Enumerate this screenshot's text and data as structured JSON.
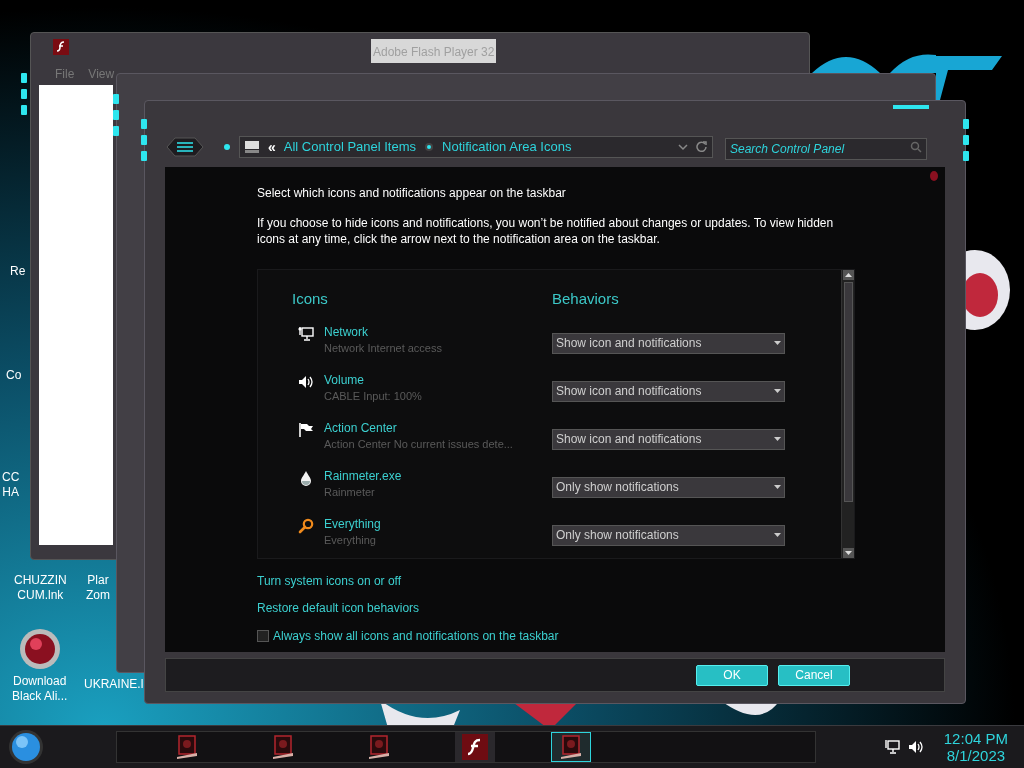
{
  "desktop_icons": [
    {
      "lines": [
        "Re"
      ],
      "kind": "partial"
    },
    {
      "lines": [
        "Co"
      ],
      "kind": "partial"
    },
    {
      "lines": [
        "CC",
        "HA"
      ],
      "kind": "partial"
    },
    {
      "lines": [
        "CHUZZIN",
        "CUM.lnk"
      ],
      "kind": "partial"
    },
    {
      "lines": [
        "Plar",
        "Zom"
      ],
      "kind": "partial"
    },
    {
      "lines": [
        "Download",
        "Black Ali..."
      ],
      "kind": "orb"
    },
    {
      "lines": [
        "UKRAINE.l"
      ],
      "kind": "partial"
    }
  ],
  "background_window": {
    "title": "Adobe Flash Player 32",
    "menu": [
      "File",
      "View"
    ]
  },
  "window": {
    "back_chevron": "«",
    "breadcrumb": [
      "All Control Panel Items",
      "Notification Area Icons"
    ],
    "search": {
      "placeholder": "Search Control Panel"
    },
    "heading": "Select which icons and notifications appear on the taskbar",
    "description": "If you choose to hide icons and notifications, you won’t be notified about changes or updates. To view hidden icons at any time, click the arrow next to the notification area on the taskbar.",
    "columns": [
      "Icons",
      "Behaviors"
    ],
    "rows": [
      {
        "kind": "network",
        "name": "Network",
        "detail": "Network Internet access",
        "behavior": "Show icon and notifications"
      },
      {
        "kind": "volume",
        "name": "Volume",
        "detail": "CABLE Input: 100%",
        "behavior": "Show icon and notifications"
      },
      {
        "kind": "flag",
        "name": "Action Center",
        "detail": "Action Center  No current issues dete...",
        "behavior": "Show icon and notifications"
      },
      {
        "kind": "drop",
        "name": "Rainmeter.exe",
        "detail": "Rainmeter",
        "behavior": "Only show notifications"
      },
      {
        "kind": "search",
        "name": "Everything",
        "detail": "Everything",
        "behavior": "Only show notifications"
      }
    ],
    "links": [
      "Turn system icons on or off",
      "Restore default icon behaviors"
    ],
    "checkbox": {
      "label": "Always show all icons and notifications on the taskbar",
      "checked": false
    },
    "buttons": [
      "OK",
      "Cancel"
    ]
  },
  "taskbar": {
    "items": [
      {
        "kind": "document",
        "selected": false
      },
      {
        "kind": "document",
        "selected": false
      },
      {
        "kind": "document",
        "selected": false
      },
      {
        "kind": "flash",
        "selected": false
      },
      {
        "kind": "document",
        "selected": true
      }
    ],
    "time": "12:04 PM",
    "date": "8/1/2023"
  }
}
